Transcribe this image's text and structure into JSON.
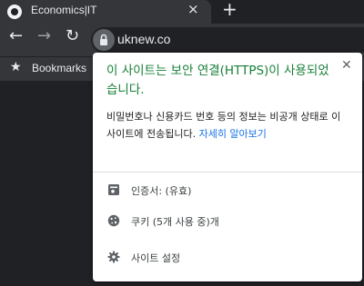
{
  "tab": {
    "title": "Economics|IT",
    "close_icon": "×",
    "new_tab_icon": "+"
  },
  "toolbar": {
    "back_icon": "←",
    "forward_icon": "→",
    "reload_icon": "↻",
    "url": "uknew.co"
  },
  "bookmarks": {
    "star_icon": "★",
    "label": "Bookmarks"
  },
  "popup": {
    "title": "이 사이트는 보안 연결(HTTPS)이 사용되었습니다.",
    "description": "비밀번호나 신용카드 번호 등의 정보는 비공개 상태로 이 사이트에 전송됩니다.",
    "learn_more": "자세히 알아보기",
    "close_icon": "✕",
    "title_color": "#188038",
    "link_color": "#1a73e8",
    "items": [
      {
        "icon": "certificate-icon",
        "label": "인증서: (유효)"
      },
      {
        "icon": "cookie-icon",
        "label": "쿠키 (5개 사용 중)개"
      },
      {
        "icon": "gear-icon",
        "label": "사이트 설정"
      }
    ]
  }
}
